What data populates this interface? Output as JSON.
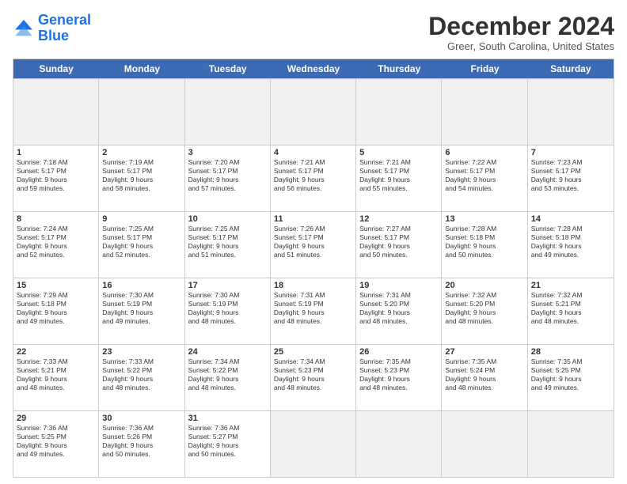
{
  "header": {
    "logo": {
      "line1": "General",
      "line2": "Blue"
    },
    "title": "December 2024",
    "location": "Greer, South Carolina, United States"
  },
  "calendar": {
    "days_of_week": [
      "Sunday",
      "Monday",
      "Tuesday",
      "Wednesday",
      "Thursday",
      "Friday",
      "Saturday"
    ],
    "weeks": [
      [
        {
          "day": "",
          "empty": true
        },
        {
          "day": "",
          "empty": true
        },
        {
          "day": "",
          "empty": true
        },
        {
          "day": "",
          "empty": true
        },
        {
          "day": "",
          "empty": true
        },
        {
          "day": "",
          "empty": true
        },
        {
          "day": "",
          "empty": true
        }
      ],
      [
        {
          "day": "1",
          "l1": "Sunrise: 7:18 AM",
          "l2": "Sunset: 5:17 PM",
          "l3": "Daylight: 9 hours",
          "l4": "and 59 minutes."
        },
        {
          "day": "2",
          "l1": "Sunrise: 7:19 AM",
          "l2": "Sunset: 5:17 PM",
          "l3": "Daylight: 9 hours",
          "l4": "and 58 minutes."
        },
        {
          "day": "3",
          "l1": "Sunrise: 7:20 AM",
          "l2": "Sunset: 5:17 PM",
          "l3": "Daylight: 9 hours",
          "l4": "and 57 minutes."
        },
        {
          "day": "4",
          "l1": "Sunrise: 7:21 AM",
          "l2": "Sunset: 5:17 PM",
          "l3": "Daylight: 9 hours",
          "l4": "and 56 minutes."
        },
        {
          "day": "5",
          "l1": "Sunrise: 7:21 AM",
          "l2": "Sunset: 5:17 PM",
          "l3": "Daylight: 9 hours",
          "l4": "and 55 minutes."
        },
        {
          "day": "6",
          "l1": "Sunrise: 7:22 AM",
          "l2": "Sunset: 5:17 PM",
          "l3": "Daylight: 9 hours",
          "l4": "and 54 minutes."
        },
        {
          "day": "7",
          "l1": "Sunrise: 7:23 AM",
          "l2": "Sunset: 5:17 PM",
          "l3": "Daylight: 9 hours",
          "l4": "and 53 minutes."
        }
      ],
      [
        {
          "day": "8",
          "l1": "Sunrise: 7:24 AM",
          "l2": "Sunset: 5:17 PM",
          "l3": "Daylight: 9 hours",
          "l4": "and 52 minutes."
        },
        {
          "day": "9",
          "l1": "Sunrise: 7:25 AM",
          "l2": "Sunset: 5:17 PM",
          "l3": "Daylight: 9 hours",
          "l4": "and 52 minutes."
        },
        {
          "day": "10",
          "l1": "Sunrise: 7:25 AM",
          "l2": "Sunset: 5:17 PM",
          "l3": "Daylight: 9 hours",
          "l4": "and 51 minutes."
        },
        {
          "day": "11",
          "l1": "Sunrise: 7:26 AM",
          "l2": "Sunset: 5:17 PM",
          "l3": "Daylight: 9 hours",
          "l4": "and 51 minutes."
        },
        {
          "day": "12",
          "l1": "Sunrise: 7:27 AM",
          "l2": "Sunset: 5:17 PM",
          "l3": "Daylight: 9 hours",
          "l4": "and 50 minutes."
        },
        {
          "day": "13",
          "l1": "Sunrise: 7:28 AM",
          "l2": "Sunset: 5:18 PM",
          "l3": "Daylight: 9 hours",
          "l4": "and 50 minutes."
        },
        {
          "day": "14",
          "l1": "Sunrise: 7:28 AM",
          "l2": "Sunset: 5:18 PM",
          "l3": "Daylight: 9 hours",
          "l4": "and 49 minutes."
        }
      ],
      [
        {
          "day": "15",
          "l1": "Sunrise: 7:29 AM",
          "l2": "Sunset: 5:18 PM",
          "l3": "Daylight: 9 hours",
          "l4": "and 49 minutes."
        },
        {
          "day": "16",
          "l1": "Sunrise: 7:30 AM",
          "l2": "Sunset: 5:19 PM",
          "l3": "Daylight: 9 hours",
          "l4": "and 49 minutes."
        },
        {
          "day": "17",
          "l1": "Sunrise: 7:30 AM",
          "l2": "Sunset: 5:19 PM",
          "l3": "Daylight: 9 hours",
          "l4": "and 48 minutes."
        },
        {
          "day": "18",
          "l1": "Sunrise: 7:31 AM",
          "l2": "Sunset: 5:19 PM",
          "l3": "Daylight: 9 hours",
          "l4": "and 48 minutes."
        },
        {
          "day": "19",
          "l1": "Sunrise: 7:31 AM",
          "l2": "Sunset: 5:20 PM",
          "l3": "Daylight: 9 hours",
          "l4": "and 48 minutes."
        },
        {
          "day": "20",
          "l1": "Sunrise: 7:32 AM",
          "l2": "Sunset: 5:20 PM",
          "l3": "Daylight: 9 hours",
          "l4": "and 48 minutes."
        },
        {
          "day": "21",
          "l1": "Sunrise: 7:32 AM",
          "l2": "Sunset: 5:21 PM",
          "l3": "Daylight: 9 hours",
          "l4": "and 48 minutes."
        }
      ],
      [
        {
          "day": "22",
          "l1": "Sunrise: 7:33 AM",
          "l2": "Sunset: 5:21 PM",
          "l3": "Daylight: 9 hours",
          "l4": "and 48 minutes."
        },
        {
          "day": "23",
          "l1": "Sunrise: 7:33 AM",
          "l2": "Sunset: 5:22 PM",
          "l3": "Daylight: 9 hours",
          "l4": "and 48 minutes."
        },
        {
          "day": "24",
          "l1": "Sunrise: 7:34 AM",
          "l2": "Sunset: 5:22 PM",
          "l3": "Daylight: 9 hours",
          "l4": "and 48 minutes."
        },
        {
          "day": "25",
          "l1": "Sunrise: 7:34 AM",
          "l2": "Sunset: 5:23 PM",
          "l3": "Daylight: 9 hours",
          "l4": "and 48 minutes."
        },
        {
          "day": "26",
          "l1": "Sunrise: 7:35 AM",
          "l2": "Sunset: 5:23 PM",
          "l3": "Daylight: 9 hours",
          "l4": "and 48 minutes."
        },
        {
          "day": "27",
          "l1": "Sunrise: 7:35 AM",
          "l2": "Sunset: 5:24 PM",
          "l3": "Daylight: 9 hours",
          "l4": "and 48 minutes."
        },
        {
          "day": "28",
          "l1": "Sunrise: 7:35 AM",
          "l2": "Sunset: 5:25 PM",
          "l3": "Daylight: 9 hours",
          "l4": "and 49 minutes."
        }
      ],
      [
        {
          "day": "29",
          "l1": "Sunrise: 7:36 AM",
          "l2": "Sunset: 5:25 PM",
          "l3": "Daylight: 9 hours",
          "l4": "and 49 minutes."
        },
        {
          "day": "30",
          "l1": "Sunrise: 7:36 AM",
          "l2": "Sunset: 5:26 PM",
          "l3": "Daylight: 9 hours",
          "l4": "and 50 minutes."
        },
        {
          "day": "31",
          "l1": "Sunrise: 7:36 AM",
          "l2": "Sunset: 5:27 PM",
          "l3": "Daylight: 9 hours",
          "l4": "and 50 minutes."
        },
        {
          "day": "",
          "empty": true
        },
        {
          "day": "",
          "empty": true
        },
        {
          "day": "",
          "empty": true
        },
        {
          "day": "",
          "empty": true
        }
      ]
    ]
  }
}
